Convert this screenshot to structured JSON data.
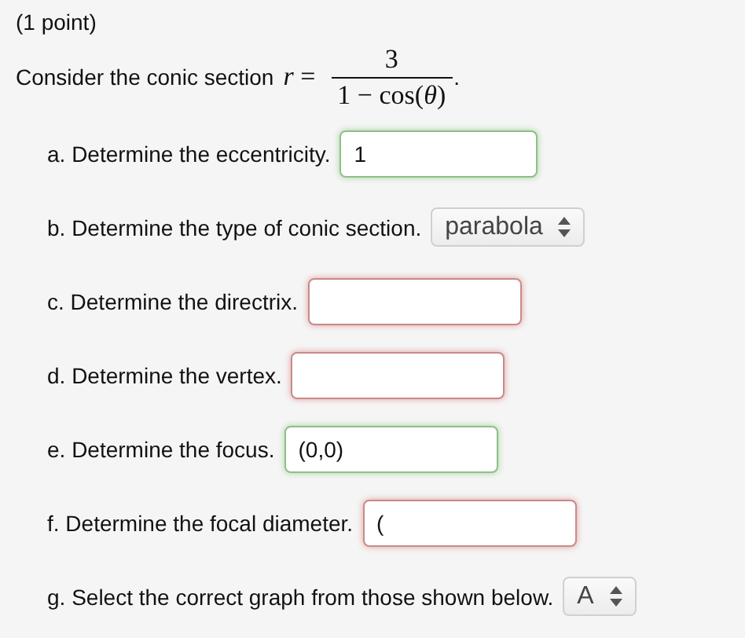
{
  "points": "(1 point)",
  "problem": {
    "intro": "Consider the conic section",
    "lhs": "*r* =",
    "numerator": "3",
    "denominator": "1 − cos(*θ*)",
    "end": "."
  },
  "parts": [
    {
      "kind": "input",
      "label": "a. Determine the eccentricity.",
      "value": "1",
      "correct": true
    },
    {
      "kind": "select",
      "label": "b. Determine the type of conic section.",
      "value": "parabola"
    },
    {
      "kind": "input",
      "label": "c. Determine the directrix.",
      "correct": false
    },
    {
      "kind": "input",
      "label": "d. Determine the vertex.",
      "correct": false
    },
    {
      "kind": "input",
      "label": "e. Determine the focus.",
      "value": "(0,0)",
      "correct": true
    },
    {
      "kind": "input",
      "label": "f. Determine the focal diameter.",
      "value": "(",
      "correct": false
    },
    {
      "kind": "select",
      "label": "g. Select the correct graph from those shown below.",
      "value": "A"
    }
  ]
}
